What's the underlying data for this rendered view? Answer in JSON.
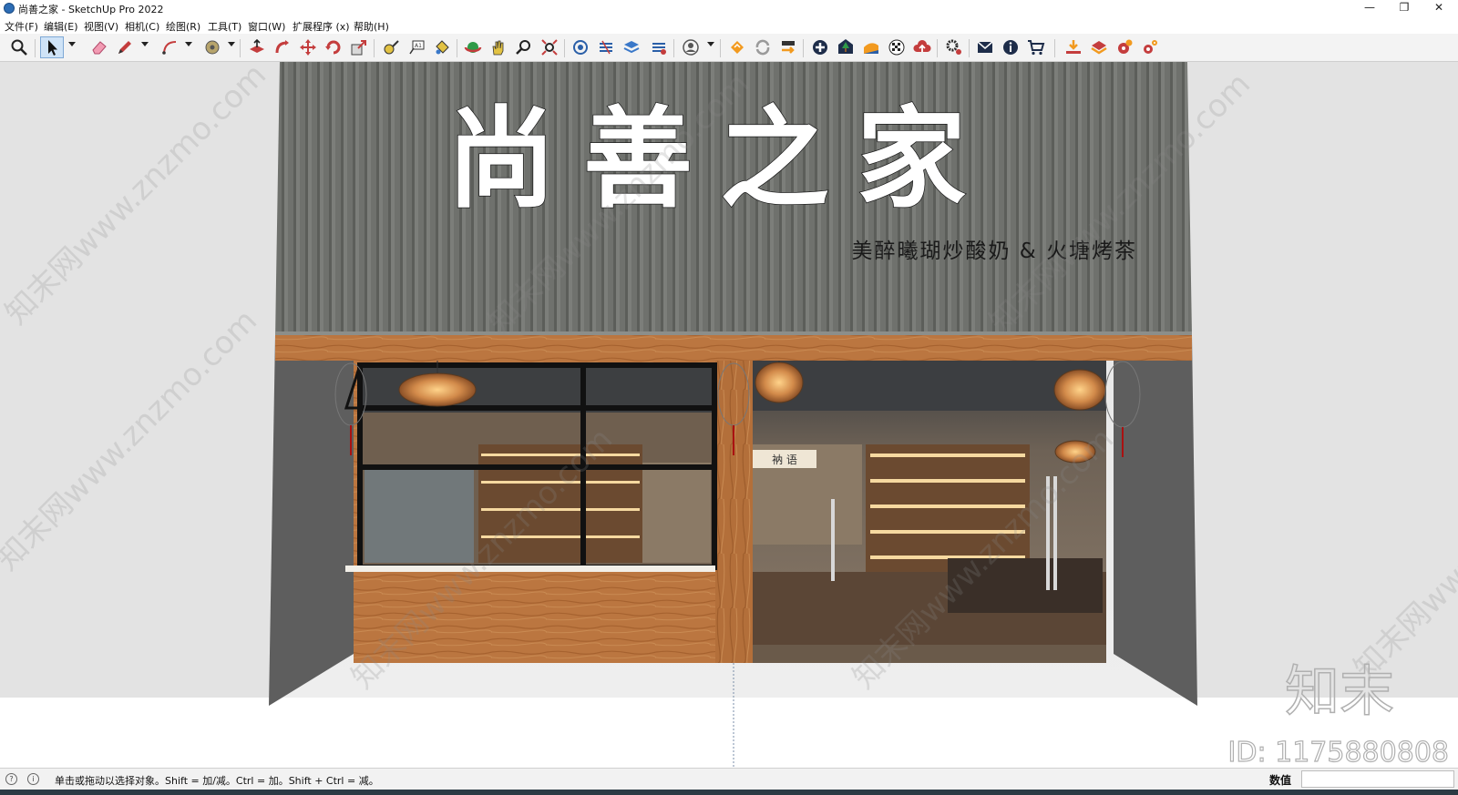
{
  "window": {
    "title": "尚善之家 - SketchUp Pro 2022",
    "minimize_glyph": "—",
    "maximize_glyph": "❐",
    "close_glyph": "✕"
  },
  "menu": [
    {
      "label": "文件(F)"
    },
    {
      "label": "编辑(E)"
    },
    {
      "label": "视图(V)"
    },
    {
      "label": "相机(C)"
    },
    {
      "label": "绘图(R)"
    },
    {
      "label": "工具(T)"
    },
    {
      "label": "窗口(W)"
    },
    {
      "label": "扩展程序 (x)"
    },
    {
      "label": "帮助(H)"
    }
  ],
  "toolbar": {
    "icons": [
      "zoom-icon",
      "select-icon",
      "eraser-icon",
      "pencil-icon",
      "arc-icon",
      "paint-icon",
      "pushpull-icon",
      "follow-me-icon",
      "move-icon",
      "rotate-icon",
      "scale-icon",
      "tape-measure-icon",
      "text-icon",
      "paint-bucket-icon",
      "orbit-icon",
      "pan-icon",
      "zoom-window-icon",
      "zoom-extents-icon",
      "warehouse-icon",
      "extension-icon",
      "layers-icon",
      "styles-icon",
      "user-icon",
      "layout-icon",
      "refresh-icon",
      "export-icon",
      "add-icon",
      "tree-icon",
      "terrain-icon",
      "checker-icon",
      "cloud-upload-icon",
      "gears-icon",
      "mail-icon",
      "info-icon",
      "cart-icon",
      "download-icon",
      "plugin-icon",
      "plugin-gear-icon",
      "settings-gear-icon"
    ]
  },
  "scene": {
    "sign_title": "尚善之家",
    "sign_subtitle": "美醉曦瑚炒酸奶 & 火塘烤茶",
    "inner_plaque": "衲 语",
    "watermark_brand": "知末",
    "watermark_id": "ID: 1175880808",
    "watermark_pattern": "知末网www.znzmo.com"
  },
  "status": {
    "hint": "单击或拖动以选择对象。Shift = 加/减。Ctrl = 加。Shift + Ctrl = 减。",
    "value_label": "数值",
    "value": ""
  },
  "colors": {
    "roof": "#6f716d",
    "wood": "#b8733c",
    "side_wall": "#5d5d5d",
    "accent": "#2d6db5"
  }
}
